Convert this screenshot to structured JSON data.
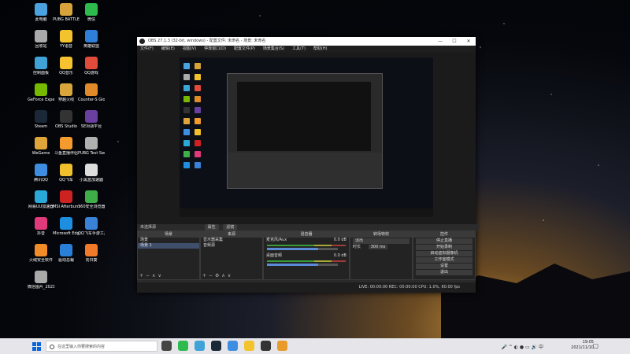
{
  "desktop": {
    "icons": [
      {
        "label": "此电脑",
        "color": "#4aa3df"
      },
      {
        "label": "PUBG BATTLEGR...",
        "color": "#d8a33a"
      },
      {
        "label": "微信",
        "color": "#2dbb4e"
      },
      {
        "label": "回收站",
        "color": "#aaaaaa"
      },
      {
        "label": "YY语音",
        "color": "#f3c32d"
      },
      {
        "label": "英雄联盟",
        "color": "#2f7fd8"
      },
      {
        "label": "控制面板",
        "color": "#3fa3d8"
      },
      {
        "label": "QQ音乐",
        "color": "#f6c22f"
      },
      {
        "label": "QQ游戏",
        "color": "#e04b3c"
      },
      {
        "label": "GeForce Experience",
        "color": "#76b900"
      },
      {
        "label": "穿越火线",
        "color": "#d8a63a"
      },
      {
        "label": "Counter-S Global Off...",
        "color": "#e08a2a"
      },
      {
        "label": "Steam",
        "color": "#1b2838"
      },
      {
        "label": "OBS Studio",
        "color": "#333333"
      },
      {
        "label": "SE对战平台",
        "color": "#6b3fa0"
      },
      {
        "label": "WeGame",
        "color": "#e0a53a"
      },
      {
        "label": "斗鱼直播伴侣",
        "color": "#f39c2d"
      },
      {
        "label": "PUBG Test Server",
        "color": "#b0b0b0"
      },
      {
        "label": "腾讯QQ",
        "color": "#3d8de0"
      },
      {
        "label": "QQ飞车",
        "color": "#f0c02d"
      },
      {
        "label": "小黑盒加速器",
        "color": "#dddddd"
      },
      {
        "label": "网易UU加速器",
        "color": "#2aa8d8"
      },
      {
        "label": "MSI Afterburner",
        "color": "#cc2222"
      },
      {
        "label": "360安全浏览器",
        "color": "#3fae49"
      },
      {
        "label": "抖音",
        "color": "#e03a7a"
      },
      {
        "label": "Microsoft Edge",
        "color": "#1e8fe0"
      },
      {
        "label": "QQ飞车手游工具",
        "color": "#3a82d8"
      },
      {
        "label": "火绒安全软件",
        "color": "#f28c28"
      },
      {
        "label": "驱动总裁",
        "color": "#2a7fd8"
      },
      {
        "label": "向日葵",
        "color": "#f07a2a"
      },
      {
        "label": "微信图片_2021110...",
        "color": "#a9a9a9"
      }
    ]
  },
  "obs": {
    "title": "OBS 27.1.3 (32-bit, windows) - 配置文件: 未命名 - 场景: 未命名",
    "menu": [
      "文件(F)",
      "编辑(E)",
      "视图(V)",
      "停靠窗口(D)",
      "配置文件(P)",
      "场景集合(S)",
      "工具(T)",
      "帮助(H)"
    ],
    "scene_strip_label": "未选择源",
    "scene_strip_buttons": [
      "属性",
      "滤镜"
    ],
    "docks": {
      "scenes": {
        "title": "场景",
        "items": [
          "场景",
          "场景 1"
        ]
      },
      "sources": {
        "title": "来源",
        "items": [
          "显示器采集",
          "音频源"
        ]
      },
      "mixer": {
        "title": "混音器",
        "channels": [
          {
            "name": "麦克风/Aux",
            "db": "0.0 dB",
            "level": 0.72
          },
          {
            "name": "桌面音频",
            "db": "0.0 dB",
            "level": 0.72
          }
        ]
      },
      "transitions": {
        "title": "转场特效",
        "type": "淡出",
        "duration_label": "时长",
        "duration": "300 ms"
      },
      "controls": {
        "title": "控件",
        "buttons": [
          "停止直播",
          "开始录制",
          "启动虚拟摄像机",
          "工作室模式",
          "设置",
          "退出"
        ]
      }
    },
    "status": "LIVE: 00:00:00   REC: 00:00:00   CPU: 1.0%, 60.00 fps"
  },
  "taskbar": {
    "search_placeholder": "在这里输入你要搜索的内容",
    "apps": [
      {
        "name": "task-view",
        "color": "#444444"
      },
      {
        "name": "wechat",
        "color": "#2dbb4e"
      },
      {
        "name": "browser",
        "color": "#3fa3d8"
      },
      {
        "name": "steam",
        "color": "#1b2838"
      },
      {
        "name": "qq",
        "color": "#3d8de0"
      },
      {
        "name": "yy",
        "color": "#f3c32d"
      },
      {
        "name": "obs",
        "color": "#333333"
      },
      {
        "name": "files",
        "color": "#e89b2a"
      }
    ],
    "time": "19:05",
    "date": "2021/11/10"
  }
}
